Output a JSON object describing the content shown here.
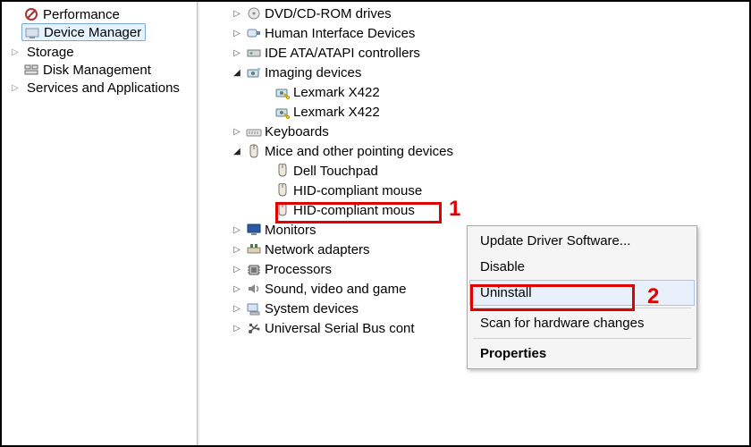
{
  "left_nav": {
    "performance": "Performance",
    "device_manager": "Device Manager",
    "storage": "Storage",
    "disk_management": "Disk Management",
    "services": "Services and Applications"
  },
  "tree": {
    "dvd": "DVD/CD-ROM drives",
    "hid": "Human Interface Devices",
    "ide": "IDE ATA/ATAPI controllers",
    "imaging": "Imaging devices",
    "lexmark1": "Lexmark X422",
    "lexmark2": "Lexmark X422",
    "keyboards": "Keyboards",
    "mice": "Mice and other pointing devices",
    "touchpad": "Dell Touchpad",
    "hid_mouse1": "HID-compliant mouse",
    "hid_mouse2": "HID-compliant mous",
    "monitors": "Monitors",
    "network": "Network adapters",
    "processors": "Processors",
    "sound": "Sound, video and game",
    "system": "System devices",
    "usb": "Universal Serial Bus cont"
  },
  "context_menu": {
    "update": "Update Driver Software...",
    "disable": "Disable",
    "uninstall": "Uninstall",
    "scan": "Scan for hardware changes",
    "properties": "Properties"
  },
  "annotations": {
    "n1": "1",
    "n2": "2"
  }
}
